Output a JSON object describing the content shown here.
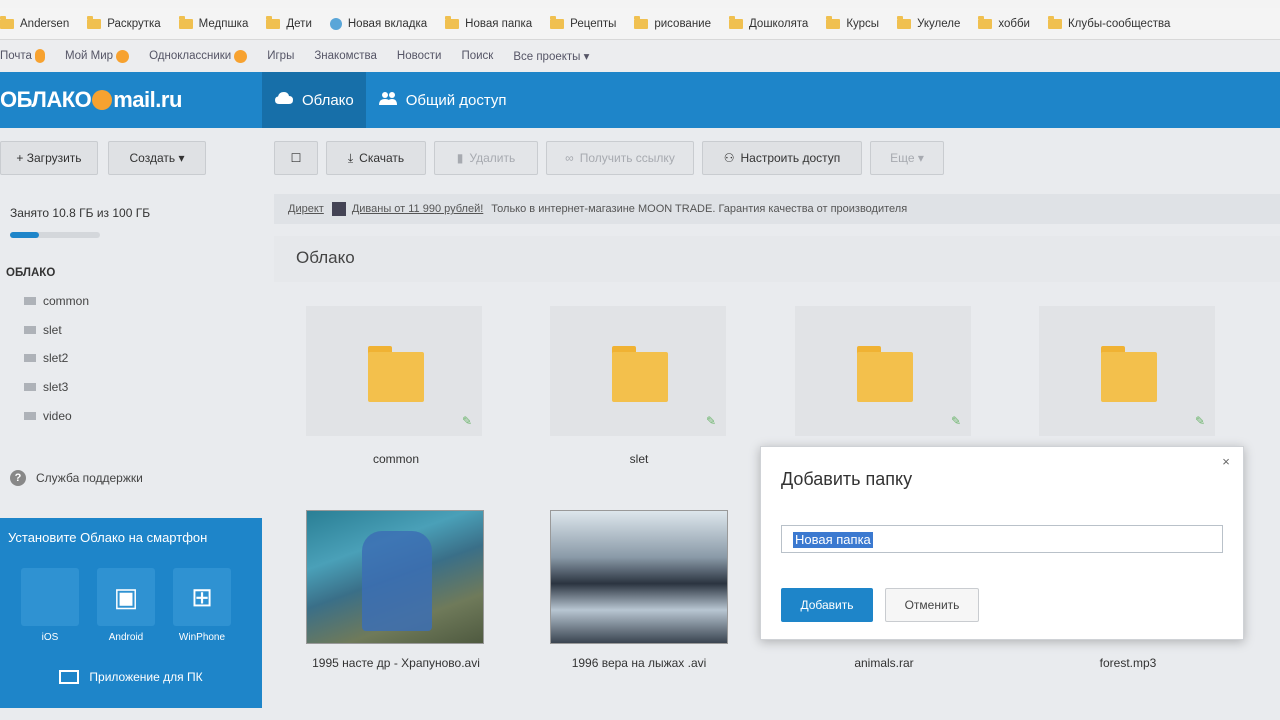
{
  "bookmarks": [
    {
      "label": "Andersen",
      "icon": "folder-icon"
    },
    {
      "label": "Раскрутка",
      "icon": "folder-icon"
    },
    {
      "label": "Медпшка",
      "icon": "folder-icon"
    },
    {
      "label": "Дети",
      "icon": "folder-icon"
    },
    {
      "label": "Новая вкладка",
      "icon": "globe-icon"
    },
    {
      "label": "Новая папка",
      "icon": "folder-icon"
    },
    {
      "label": "Рецепты",
      "icon": "folder-icon"
    },
    {
      "label": "рисование",
      "icon": "folder-icon"
    },
    {
      "label": "Дошколята",
      "icon": "folder-icon"
    },
    {
      "label": "Курсы",
      "icon": "folder-icon"
    },
    {
      "label": "Укулеле",
      "icon": "folder-icon"
    },
    {
      "label": "хобби",
      "icon": "folder-icon"
    },
    {
      "label": "Клубы-сообщества",
      "icon": "folder-icon"
    }
  ],
  "portal_nav": {
    "items": [
      "Почта",
      "Мой Мир",
      "Одноклассники",
      "Игры",
      "Знакомства",
      "Новости",
      "Поиск",
      "Все проекты ▾"
    ],
    "mail_badge": "",
    "mir_badge": ""
  },
  "header": {
    "logo_left": "ОБЛАКО",
    "logo_right": "mail.ru",
    "tab_cloud": "Облако",
    "tab_shared": "Общий доступ"
  },
  "toolbar": {
    "upload": "+ Загрузить",
    "create": "Создать ▾",
    "select_all": "☐",
    "download": "Скачать",
    "delete": "Удалить",
    "get_link": "Получить ссылку",
    "configure_access": "Настроить доступ",
    "more": "Еще ▾"
  },
  "sidebar": {
    "quota": "Занято 10.8 ГБ из 100 ГБ",
    "quota_fraction": 0.108,
    "root": "ОБЛАКО",
    "folders": [
      "common",
      "slet",
      "slet2",
      "slet3",
      "video"
    ],
    "support": "Служба поддержки",
    "mobile_title": "Установите Облако на смартфон",
    "platforms": [
      "iOS",
      "Android",
      "WinPhone"
    ],
    "pc_app": "Приложение для ПК"
  },
  "adbar": {
    "label": "Директ",
    "link": "Диваны от 11 990 рублей!",
    "text": "Только в интернет-магазине MOON TRADE. Гарантия качества от производителя"
  },
  "breadcrumb": "Облако",
  "files": {
    "folders": [
      "common",
      "slet",
      "",
      ""
    ],
    "videos": [
      "1995 насте др - Храпуново.avi",
      "1996 вера на лыжах .avi"
    ],
    "others": [
      "animals.rar",
      "forest.mp3"
    ]
  },
  "dialog": {
    "title": "Добавить папку",
    "close": "×",
    "input_value": "Новая папка",
    "add": "Добавить",
    "cancel": "Отменить"
  },
  "colors": {
    "brand": "#1e85c9",
    "folder": "#f3c04c"
  }
}
